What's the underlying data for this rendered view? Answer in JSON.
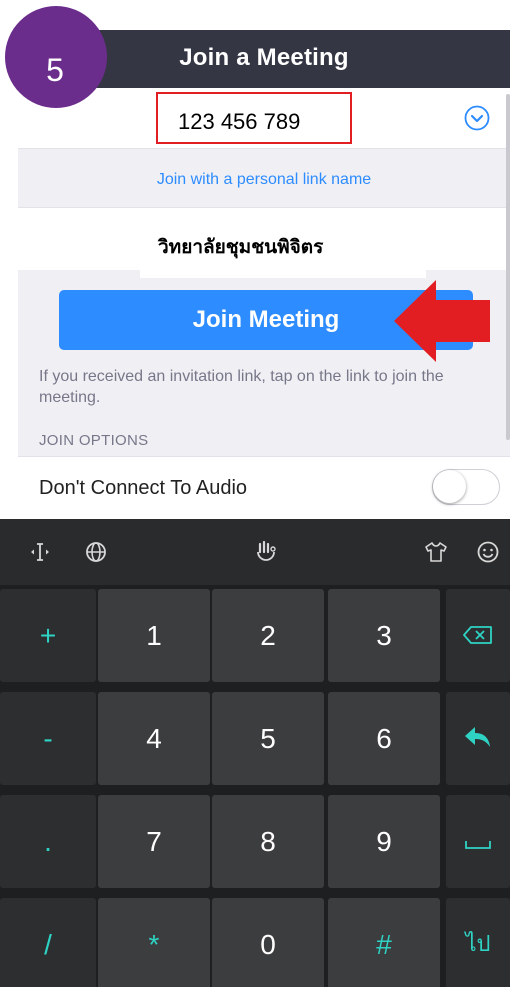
{
  "step_badge": "5",
  "header": {
    "title": "Join a Meeting"
  },
  "meeting_id": {
    "value": "123 456 789"
  },
  "personal_link": "Join with a personal link name",
  "display_name": "วิทยาลัยชุมชนพิจิตร",
  "join_button": "Join Meeting",
  "invite_note": "If you received an invitation link, tap on the link to join the meeting.",
  "join_options_label": "JOIN OPTIONS",
  "audio_option": {
    "label": "Don't Connect To Audio",
    "enabled": false
  },
  "colors": {
    "header_bg": "#343644",
    "badge": "#6b2d8c",
    "accent_blue": "#2d8cff",
    "highlight_red": "#e21e23",
    "keyboard_accent": "#2ed3c4"
  },
  "keyboard": {
    "toolbar_icons": [
      "cursor-icon",
      "globe-icon",
      "voice-input-icon",
      "theme-shirt-icon",
      "emoji-icon"
    ],
    "rows": [
      {
        "left": "+",
        "keys": [
          "1",
          "2",
          "3"
        ],
        "right": "backspace-icon"
      },
      {
        "left": "-",
        "keys": [
          "4",
          "5",
          "6"
        ],
        "right": "enter-icon"
      },
      {
        "left": ".",
        "keys": [
          "7",
          "8",
          "9"
        ],
        "right": "space-icon"
      },
      {
        "left": "/",
        "keys": [
          "*",
          "0",
          "#"
        ],
        "right": "ไป"
      }
    ]
  }
}
